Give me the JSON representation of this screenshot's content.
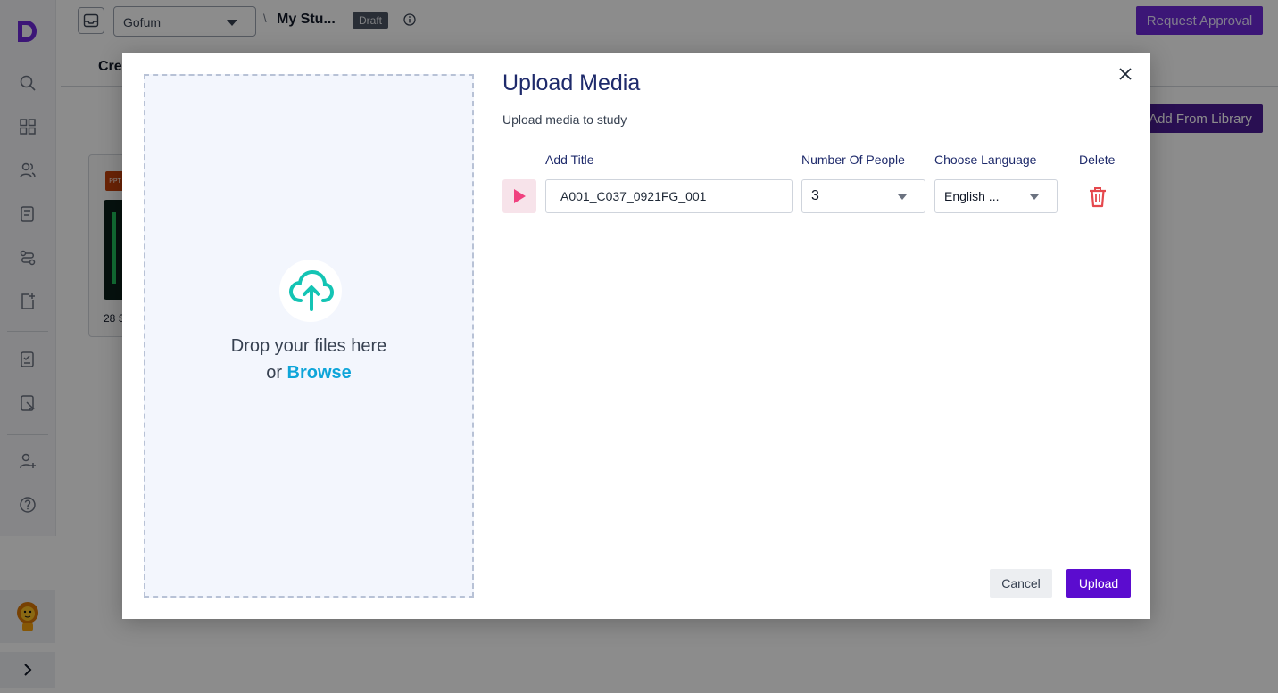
{
  "app": {
    "workspace_select": "Gofum",
    "breadcrumb_separator": "\\",
    "study_title": "My Stu...",
    "status_badge": "Draft",
    "request_approval": "Request Approval",
    "tab_create": "Cre",
    "add_from_library": "Add From Library",
    "media_card": {
      "file_badge": "PPT",
      "caption": "28 S"
    }
  },
  "sidebar": {
    "logo": "D",
    "items": [
      "search-icon",
      "grid-icon",
      "users-icon",
      "survey-icon",
      "flow-icon",
      "add-file-icon",
      "checklist-icon",
      "review-icon",
      "add-user-icon",
      "help-icon"
    ],
    "avatar": "lion-avatar",
    "expand": "chevron-right-icon"
  },
  "modal": {
    "title": "Upload Media",
    "subtitle": "Upload media to study",
    "dropzone": {
      "line1": "Drop your files here",
      "line2_prefix": "or ",
      "browse": "Browse"
    },
    "columns": {
      "title": "Add Title",
      "people": "Number Of People",
      "language": "Choose Language",
      "delete": "Delete"
    },
    "row": {
      "title_value": "A001_C037_0921FG_001",
      "people_value": "3",
      "language_value": "English ..."
    },
    "cancel": "Cancel",
    "upload": "Upload"
  },
  "colors": {
    "accent": "#5b0ccf",
    "browse_link": "#0ea5d9",
    "cloud_icon": "#14c4b4",
    "delete_icon": "#e5484d",
    "play_icon": "#f0417f"
  }
}
